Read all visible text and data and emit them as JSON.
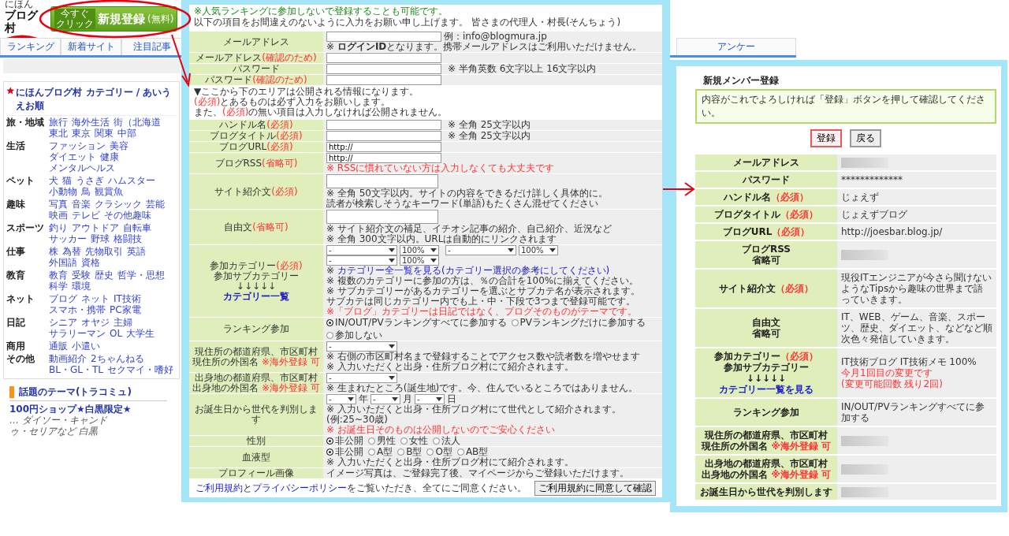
{
  "header": {
    "logo_small": "にほん",
    "logo": "ブログ村",
    "signup": {
      "badge_lines": [
        "今すぐ",
        "クリック"
      ],
      "label": "新規登録",
      "suffix": "(無料)"
    }
  },
  "nav_tabs": [
    {
      "label": "ランキング"
    },
    {
      "label": "新着サイト"
    },
    {
      "label": "注目記事"
    },
    {
      "label": "アンケー"
    }
  ],
  "category_box": {
    "title": "にほんブログ村 カテゴリー / あいうえお順",
    "rows": [
      {
        "name": "旅・地域",
        "links": [
          "旅行",
          "海外生活",
          "街（北海道",
          "東北",
          "東京",
          "関東",
          "中部"
        ]
      },
      {
        "name": "生活",
        "links": [
          "ファッション",
          "美容",
          "ダイエット",
          "健康",
          "メンタルヘルス"
        ]
      },
      {
        "name": "ペット",
        "links": [
          "犬",
          "猫",
          "うさぎ",
          "ハムスター",
          "小動物",
          "鳥",
          "観賞魚"
        ]
      },
      {
        "name": "趣味",
        "links": [
          "写真",
          "音楽",
          "クラシック",
          "芸能",
          "映画",
          "テレビ",
          "その他趣味"
        ]
      },
      {
        "name": "スポーツ",
        "links": [
          "釣り",
          "アウトドア",
          "自転車",
          "サッカー",
          "野球",
          "格闘技"
        ]
      },
      {
        "name": "仕事",
        "links": [
          "株",
          "為替",
          "先物取引",
          "英語",
          "外国語",
          "資格"
        ]
      },
      {
        "name": "教育",
        "links": [
          "教育",
          "受験",
          "歴史",
          "哲学・思想",
          "科学",
          "環境"
        ]
      },
      {
        "name": "ネット",
        "links": [
          "ブログ",
          "ネット",
          "IT技術",
          "スマホ・携帯",
          "PC家電"
        ]
      },
      {
        "name": "日記",
        "links": [
          "シニア",
          "オヤジ",
          "主婦",
          "サラリーマン",
          "OL",
          "大学生"
        ]
      },
      {
        "name": "商用",
        "links": [
          "通販",
          "小遣い"
        ]
      },
      {
        "name": "その他",
        "links": [
          "動画紹介",
          "2ちゃんねる",
          "BL・GL・TL",
          "セクマイ・嗜好"
        ]
      }
    ]
  },
  "theme_section": {
    "title": "話題のテーマ(トラコミュ)",
    "link": "100円ショップ★白黒限定★",
    "excerpt": "… ダイソー・キャンドゥ・セリアなど 白黒"
  },
  "registration_form": {
    "intro": [
      {
        "text": "※人気ランキングに参加しないで登録することも可能です。",
        "highlight": true
      },
      {
        "text": "以下の項目をお間違えのないように入力をお願い申し上げます。 皆さまの代理人・村長(そんちょう)",
        "highlight": false
      }
    ],
    "rows": [
      {
        "kind": "field",
        "label": [
          {
            "text": "メールアドレス"
          }
        ],
        "items": [
          {
            "kind": "input",
            "example": "例：info@blogmura.jp"
          },
          {
            "kind": "note",
            "text": "※ **ログインID**となります。携帯メールアドレスはご利用いただけません。",
            "warning": false
          }
        ]
      },
      {
        "kind": "field",
        "label": [
          {
            "text": "メールアドレス",
            "note": "(確認のため)"
          }
        ],
        "items": [
          {
            "kind": "input"
          }
        ]
      },
      {
        "kind": "field",
        "label": [
          {
            "text": "パスワード"
          }
        ],
        "items": [
          {
            "kind": "input"
          },
          {
            "kind": "note",
            "text": "※ 半角英数 6文字以上 16文字以内",
            "warning": false
          }
        ]
      },
      {
        "kind": "field",
        "label": [
          {
            "text": "パスワード",
            "note": "(確認のため)"
          }
        ],
        "items": [
          {
            "kind": "input"
          }
        ]
      },
      {
        "kind": "section",
        "lines": [
          {
            "text": "▼ここから下のエリアは公開される情報になります。"
          },
          {
            "note": "(必須)",
            "text": "とあるものは必ず入力をお願いします。"
          },
          {
            "before": "また、",
            "note": "(必須)",
            "text": "の無い項目は入力しなければ公開されません。"
          }
        ]
      },
      {
        "kind": "field",
        "label": [
          {
            "text": "ハンドル名",
            "note": "(必須)"
          }
        ],
        "items": [
          {
            "kind": "input"
          },
          {
            "kind": "note",
            "text": "※ 全角 25文字以内",
            "warning": false
          }
        ]
      },
      {
        "kind": "field",
        "label": [
          {
            "text": "ブログタイトル",
            "note": "(必須)"
          }
        ],
        "items": [
          {
            "kind": "input"
          },
          {
            "kind": "note",
            "text": "※ 全角 25文字以内",
            "warning": false
          }
        ]
      },
      {
        "kind": "field",
        "label": [
          {
            "text": "ブログURL",
            "note": "(必須)"
          }
        ],
        "items": [
          {
            "kind": "input",
            "value": "http://"
          }
        ]
      },
      {
        "kind": "field",
        "label": [
          {
            "text": "ブログRSS",
            "note": "(省略可)"
          }
        ],
        "items": [
          {
            "kind": "input",
            "value": "http://"
          },
          {
            "kind": "note",
            "text": "※ RSSに慣れていない方は入力しなくても大丈夫です",
            "warning": true
          }
        ]
      },
      {
        "kind": "field",
        "label": [
          {
            "text": "サイト紹介文",
            "note": "(必須)"
          }
        ],
        "items": [
          {
            "kind": "textarea"
          },
          {
            "kind": "note",
            "text": "※ 全角 50文字以内。サイトの内容をできるだけ詳しく具体的に。",
            "warning": false
          },
          {
            "kind": "note",
            "text": "読者が検索しそうなキーワード(単語)もたくさん混ぜてください",
            "warning": false
          }
        ]
      },
      {
        "kind": "field",
        "label": [
          {
            "text": "自由文",
            "note": "(省略可)"
          }
        ],
        "items": [
          {
            "kind": "textarea"
          },
          {
            "kind": "note",
            "text": "※ サイト紹介文の補足、イチオシ記事の紹介、自己紹介、近況など",
            "warning": false
          },
          {
            "kind": "note",
            "text": "※ 全角 300文字以内。URLは自動的にリンクされます",
            "warning": false
          }
        ]
      },
      {
        "kind": "field",
        "label": [
          {
            "text": "参加カテゴリー",
            "note": "(必須)"
          },
          {
            "text": "参加サブカテゴリー"
          },
          {
            "text": "↓↓↓↓↓"
          },
          {
            "kind": "link",
            "text": "カテゴリー一覧"
          }
        ],
        "items": [
          {
            "kind": "selects",
            "options": [
              {
                "value": "-"
              },
              {
                "value": "100%"
              }
            ]
          },
          {
            "kind": "selects",
            "options": [
              {
                "value": "-"
              },
              {
                "value": "100%"
              }
            ]
          },
          {
            "kind": "selects",
            "options": [
              {
                "value": "-"
              },
              {
                "value": "100%"
              }
            ]
          },
          {
            "kind": "link_note",
            "prefix": "※",
            "link": "カテゴリー全一覧を見る(カテゴリー選択の参考にしてください)"
          },
          {
            "kind": "note",
            "text": "※ 複数のカテゴリーに参加の方は、％の合計を100%に揃えてください。",
            "warning": false
          },
          {
            "kind": "note",
            "text": "※ サブカテゴリーがあるカテゴリーを選ぶとサブカテ名が表示されます。",
            "warning": false
          },
          {
            "kind": "note",
            "text": "サブカテは同じカテゴリー内でも上・中・下段で3つまで登録可能です。",
            "warning": false
          },
          {
            "kind": "note",
            "text": "※「ブログ」カテゴリーは日記ではなく、ブログそのものがテーマです。",
            "warning": true
          }
        ]
      },
      {
        "kind": "field",
        "label": [
          {
            "text": "ランキング参加"
          }
        ],
        "items": [
          {
            "kind": "radios",
            "options": [
              {
                "label": "IN/OUT/PVランキングすべてに参加する",
                "selected": true
              },
              {
                "label": "PVランキングだけに参加する",
                "selected": false
              },
              {
                "label": "参加しない",
                "selected": false
              }
            ]
          }
        ]
      },
      {
        "kind": "field",
        "label": [
          {
            "text": "現住所の都道府県、市区町村"
          },
          {
            "text": "現住所の外国名 ",
            "note": "※海外登録 可"
          }
        ],
        "items": [
          {
            "kind": "selects",
            "options": [
              {
                "value": "-"
              }
            ]
          },
          {
            "kind": "note",
            "text": "※ 右側の市区町村名まで登録することでアクセス数や読者数を増やせます",
            "warning": false
          },
          {
            "kind": "note",
            "text": "※ 入力いただくと出身・住所ブログ村にて紹介されます。",
            "warning": false
          }
        ]
      },
      {
        "kind": "field",
        "label": [
          {
            "text": "出身地の都道府県、市区町村"
          },
          {
            "text": "出身地の外国名 ",
            "note": "※海外登録 可"
          }
        ],
        "items": [
          {
            "kind": "selects",
            "options": [
              {
                "value": "-"
              }
            ]
          },
          {
            "kind": "note",
            "text": "※ 生まれたところ(誕生地)です。今、住んでいるところではありません。",
            "warning": false
          }
        ]
      },
      {
        "kind": "field",
        "label": [
          {
            "text": "お誕生日から世代を判別します"
          }
        ],
        "items": [
          {
            "kind": "selects",
            "options": [
              {
                "value": "-",
                "unit": "年"
              },
              {
                "value": "-",
                "unit": "月"
              },
              {
                "value": "-",
                "unit": "日"
              }
            ]
          },
          {
            "kind": "note",
            "text": "※ 入力いただくと出身・住所ブログ村にて世代として紹介されます。(例:25~30歳)",
            "warning": false
          },
          {
            "kind": "note",
            "text": "※ お誕生日そのものは公開しないのでご安心ください",
            "warning": true
          }
        ]
      },
      {
        "kind": "field",
        "label": [
          {
            "text": "性別"
          }
        ],
        "items": [
          {
            "kind": "radios",
            "options": [
              {
                "label": "非公開",
                "selected": true
              },
              {
                "label": "男性",
                "selected": false
              },
              {
                "label": "女性",
                "selected": false
              },
              {
                "label": "法人",
                "selected": false
              }
            ]
          }
        ]
      },
      {
        "kind": "field",
        "label": [
          {
            "text": "血液型"
          }
        ],
        "items": [
          {
            "kind": "radios",
            "options": [
              {
                "label": "非公開",
                "selected": true
              },
              {
                "label": "A型",
                "selected": false
              },
              {
                "label": "B型",
                "selected": false
              },
              {
                "label": "O型",
                "selected": false
              },
              {
                "label": "AB型",
                "selected": false
              }
            ]
          },
          {
            "kind": "note",
            "text": "※ 入力いただくと出身・住所ブログ村にて紹介されます。",
            "warning": false
          }
        ]
      },
      {
        "kind": "field",
        "label": [
          {
            "text": "プロフィール画像"
          }
        ],
        "items": [
          {
            "kind": "text",
            "text": "イメージ写真は、ご登録完了後、マイページからご登録いただけます。"
          }
        ]
      }
    ],
    "consent": [
      {
        "kind": "link",
        "text": "ご利用規約"
      },
      {
        "kind": "text",
        "text": "と"
      },
      {
        "kind": "link",
        "text": "プライバシーポリシー"
      },
      {
        "kind": "text",
        "text": "をご覧いただき、全てにご同意ください。"
      }
    ],
    "submit": "ご利用規約に同意して確認"
  },
  "confirmation": {
    "title": "新規メンバー登録",
    "message": "内容がこれでよろしければ「登録」ボタンを押して確認してください。",
    "buttons": [
      {
        "label": "登録",
        "highlighted": true
      },
      {
        "label": "戻る",
        "highlighted": false
      }
    ],
    "rows": [
      {
        "label": [
          {
            "text": "メールアドレス"
          }
        ],
        "kind": "blurred"
      },
      {
        "label": [
          {
            "text": "パスワード"
          }
        ],
        "kind": "text",
        "value": "*************"
      },
      {
        "label": [
          {
            "text": "ハンドル名",
            "note": "（必須）"
          }
        ],
        "kind": "text",
        "value": "じょえず"
      },
      {
        "label": [
          {
            "text": "ブログタイトル",
            "note": "（必須）"
          }
        ],
        "kind": "text",
        "value": "じょえずブログ"
      },
      {
        "label": [
          {
            "text": "ブログURL",
            "note": "（必須）"
          }
        ],
        "kind": "text",
        "value": "http://joesbar.blog.jp/"
      },
      {
        "label": [
          {
            "text": "ブログRSS"
          },
          {
            "text": "省略可"
          }
        ],
        "kind": "blurred"
      },
      {
        "label": [
          {
            "text": "サイト紹介文",
            "note": "（必須）"
          }
        ],
        "kind": "text",
        "value": "現役ITエンジニアが今さら聞けないようなTipsから趣味の世界まで語っていきます。"
      },
      {
        "label": [
          {
            "text": "自由文"
          },
          {
            "text": "省略可"
          }
        ],
        "kind": "text",
        "value": "IT、WEB、ゲーム、音楽、スポーツ、歴史、ダイエット、などなど順次色々発信していきます。"
      },
      {
        "label": [
          {
            "text": "参加カテゴリー",
            "note": "（必須）"
          },
          {
            "text": "参加サブカテゴリー"
          },
          {
            "text": "↓↓↓↓↓"
          },
          {
            "kind": "link",
            "text": "カテゴリー一覧を見る"
          }
        ],
        "kind": "text",
        "value": "IT技術ブログ IT技術メモ 100%",
        "notice": "今月1回目の変更です(変更可能回数 残り2回)"
      },
      {
        "label": [
          {
            "text": "ランキング参加"
          }
        ],
        "kind": "text",
        "value": "IN/OUT/PVランキングすべてに参加する"
      },
      {
        "label": [
          {
            "text": "現住所の都道府県、市区町村"
          },
          {
            "text": "現住所の外国名 ",
            "note": "※海外登録 可"
          }
        ],
        "kind": "blurred"
      },
      {
        "label": [
          {
            "text": "出身地の都道府県、市区町村"
          },
          {
            "text": "出身地の外国名 ",
            "note": "※海外登録 可"
          }
        ],
        "kind": "blurred"
      },
      {
        "label": [
          {
            "text": "お誕生日から世代を判別します"
          }
        ],
        "kind": "blurred"
      }
    ]
  }
}
